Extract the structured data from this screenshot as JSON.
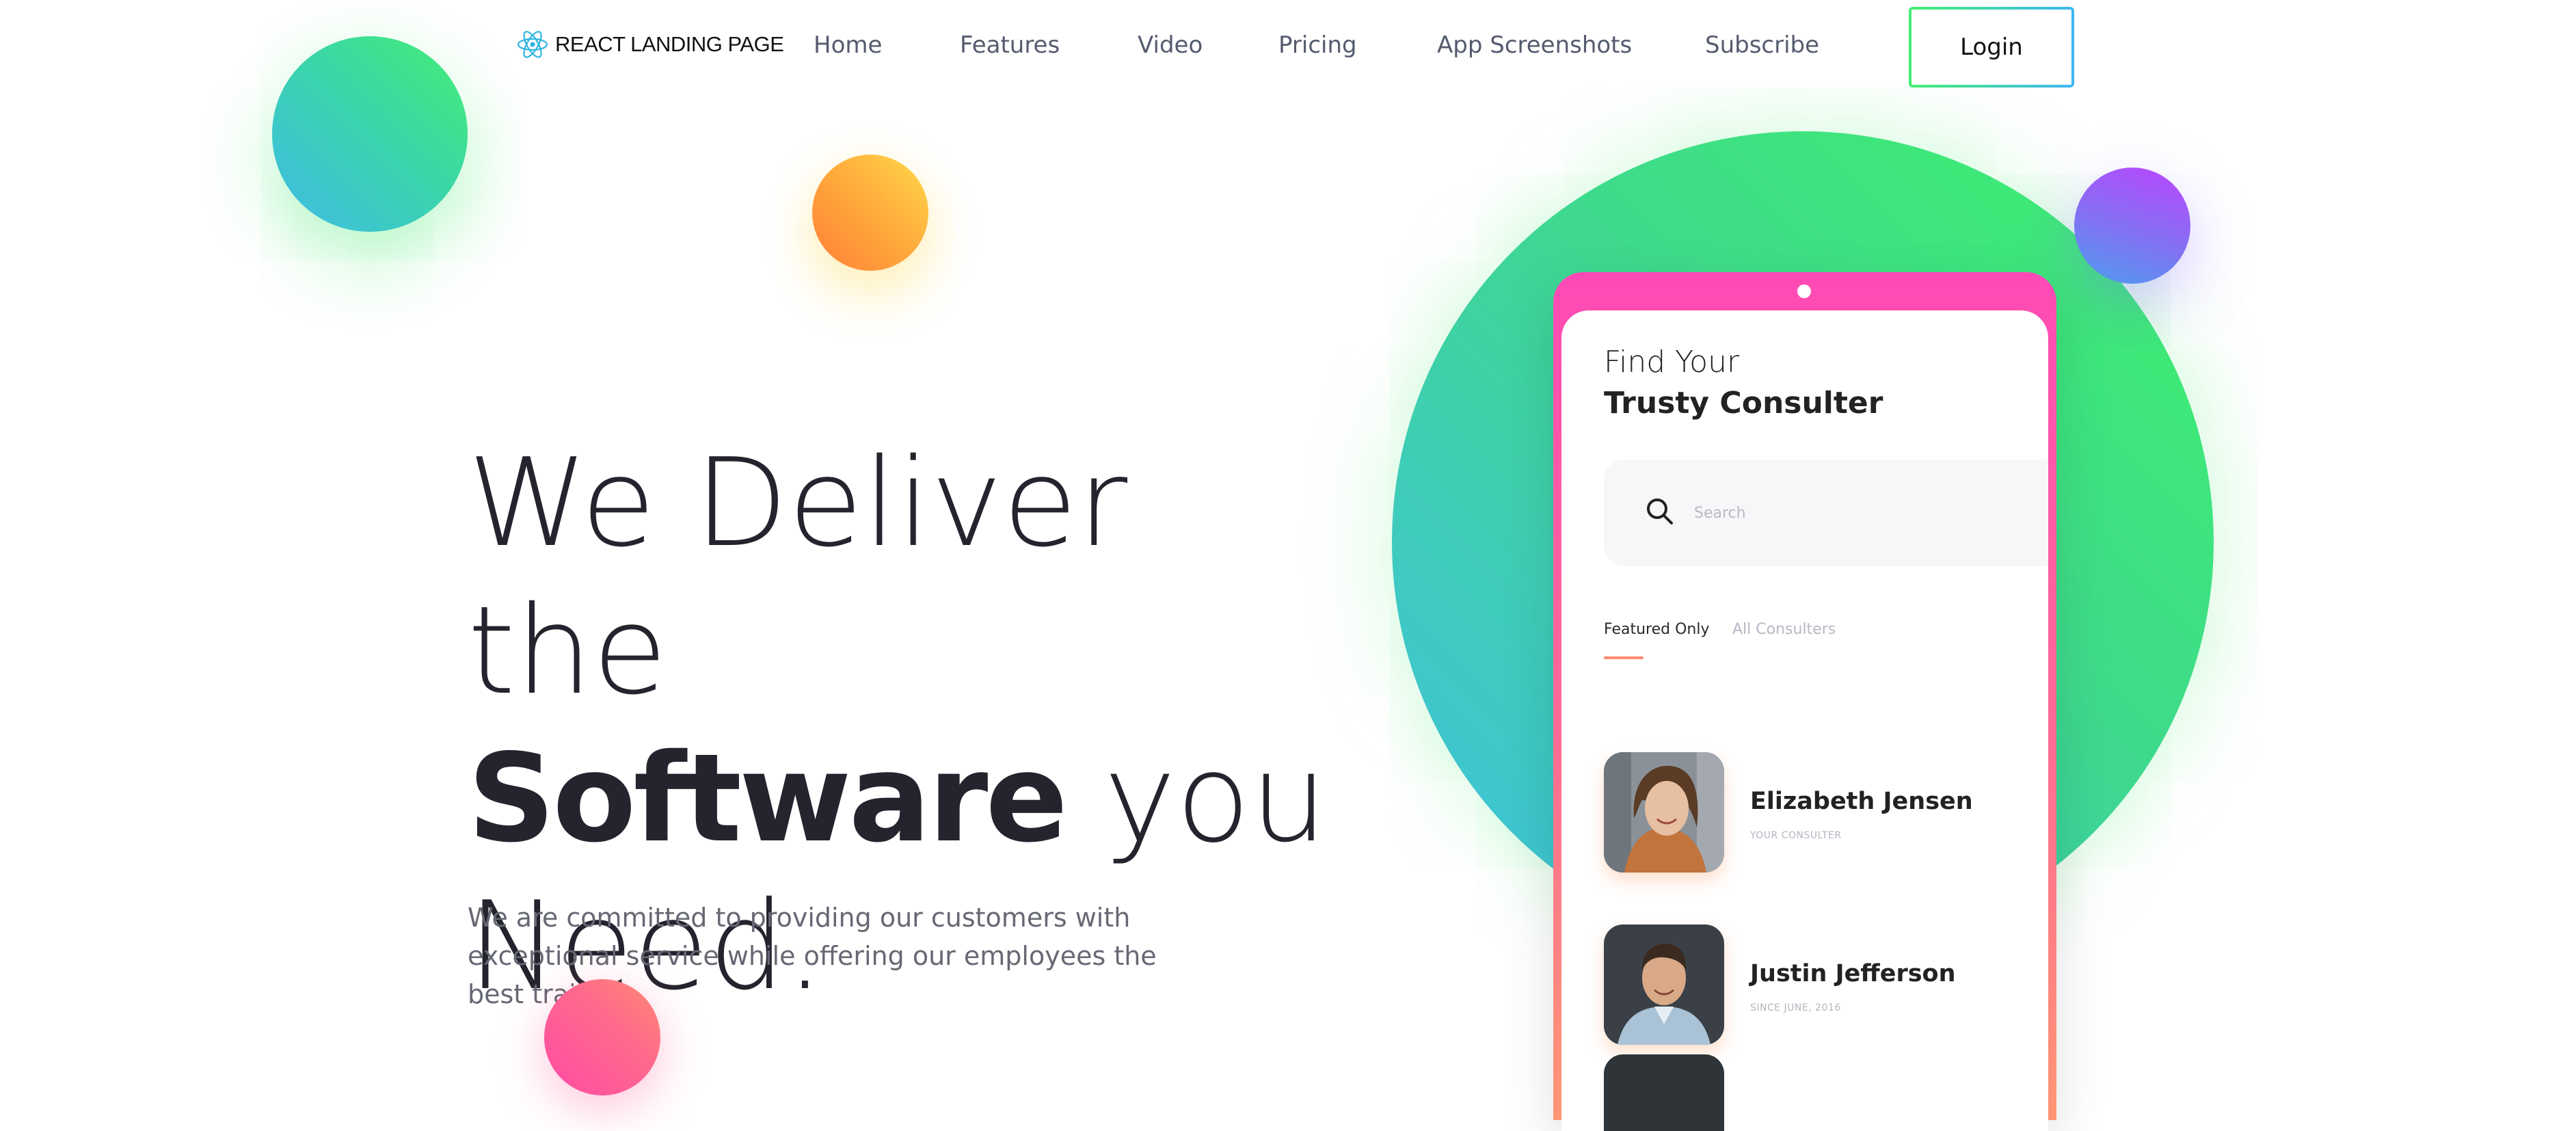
{
  "brand": {
    "name": "REACT LANDING PAGE",
    "logo_icon": "react-atom-icon"
  },
  "nav": {
    "items": [
      {
        "label": "Home"
      },
      {
        "label": "Features"
      },
      {
        "label": "Video"
      },
      {
        "label": "Pricing"
      },
      {
        "label": "App Screenshots"
      },
      {
        "label": "Subscribe"
      }
    ],
    "login_label": "Login"
  },
  "hero": {
    "title_part1": "We Deliver the",
    "title_strong": "Software",
    "title_part2": " you",
    "title_part3": "Need.",
    "description": "We are committed to providing our customers with exceptional service while offering our employees the best training."
  },
  "phone": {
    "title_line1": "Find Your",
    "title_line2": "Trusty Consulter",
    "search_placeholder": "Search",
    "search_icon": "search-icon",
    "tabs": [
      {
        "label": "Featured Only",
        "active": true
      },
      {
        "label": "All Consulters",
        "active": false
      }
    ],
    "consultants": [
      {
        "name": "Elizabeth Jensen",
        "subtitle": "YOUR CONSULTER"
      },
      {
        "name": "Justin Jefferson",
        "subtitle": "SINCE JUNE, 2016"
      }
    ]
  },
  "colors": {
    "accent_green": "#44ef73",
    "accent_blue": "#3fbbe8",
    "accent_pink": "#ff4ab6",
    "accent_orange": "#ff8a6e",
    "text_dark": "#24242e"
  }
}
